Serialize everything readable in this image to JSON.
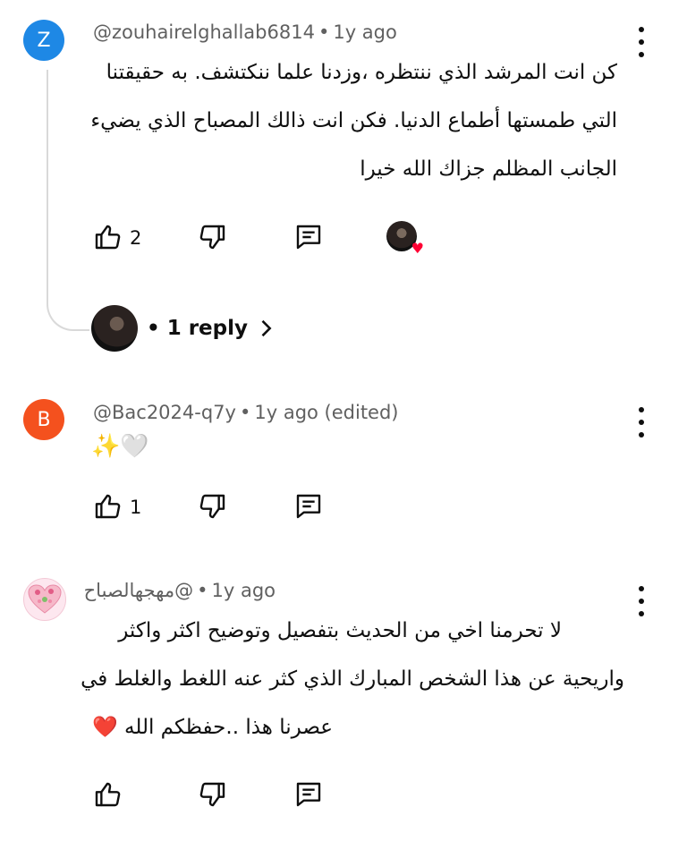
{
  "comments": [
    {
      "avatar_letter": "Z",
      "avatar_color": "#1e88e5",
      "author": "@zouhairelghallab6814",
      "time": "1y ago",
      "lines": [
        "كن انت المرشد  الذي ننتظره ،وزدنا علما  ننكتشف. به حقيقتنا",
        "التي طمستها أطماع الدنيا. فكن انت ذالك المصباح الذي يضيء",
        "الجانب المظلم  جزاك الله خيرا"
      ],
      "likes": "2",
      "creator_heart": true,
      "replies_label": "• 1 reply"
    },
    {
      "avatar_letter": "B",
      "avatar_color": "#f4511e",
      "author": "@Bac2024-q7y",
      "time": "1y ago (edited)",
      "emoji_text": "✨🤍",
      "likes": "1"
    },
    {
      "author": "@مهجهالصباح",
      "time": "1y ago",
      "lines": [
        "لا تحرمنا اخي من الحديث بتفصيل وتوضيح  اكثر واكثر",
        "واريحية عن هذا الشخص المبارك الذي كثر عنه اللغط والغلط في",
        "عصرنا هذا ..حفظكم الله ❤️"
      ],
      "likes": ""
    }
  ],
  "icons": {
    "like": "thumbs-up-icon",
    "dislike": "thumbs-down-icon",
    "reply": "comment-reply-icon",
    "more": "more-vert-icon"
  }
}
